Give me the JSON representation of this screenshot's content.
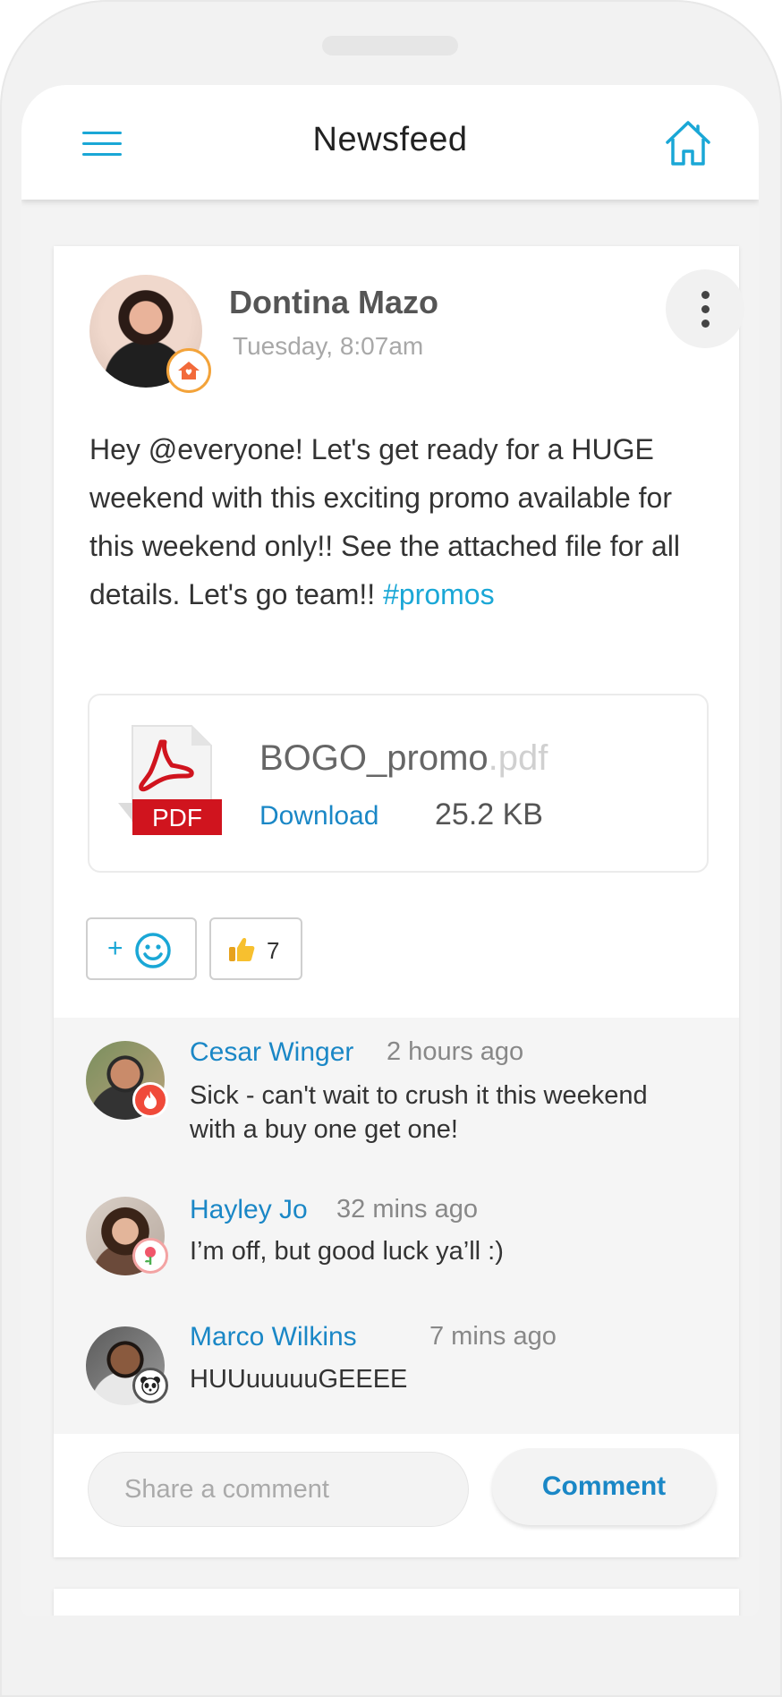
{
  "header": {
    "title": "Newsfeed",
    "menu_icon": "hamburger-menu-icon",
    "home_icon": "home-icon"
  },
  "post": {
    "author": "Dontina Mazo",
    "timestamp": "Tuesday, 8:07am",
    "body_text": "Hey @everyone! Let's get ready for a HUGE weekend with this exciting promo available for this weekend only!! See the attached file for all details. Let's go team!!",
    "hashtag": "#promos",
    "attachment": {
      "file_base": "BOGO_promo",
      "file_ext": ".pdf",
      "icon_label": "PDF",
      "download_label": "Download",
      "size": "25.2 KB"
    },
    "reactions": {
      "add_label": "+",
      "like_count": "7"
    }
  },
  "comments": [
    {
      "name": "Cesar Winger",
      "time": "2 hours ago",
      "text": "Sick - can't wait to crush it this weekend with a buy one get one!",
      "badge": "fire-icon"
    },
    {
      "name": "Hayley Jo",
      "time": "32 mins ago",
      "text": "I’m off, but good luck ya’ll :)",
      "badge": "flower-icon"
    },
    {
      "name": "Marco Wilkins",
      "time": "7 mins ago",
      "text": "HUUuuuuuGEEEE",
      "badge": "panda-icon"
    }
  ],
  "composer": {
    "placeholder": "Share a comment",
    "button_label": "Comment"
  },
  "colors": {
    "accent": "#1aa7d6",
    "link": "#1a87c6",
    "pdf_red": "#d0141e"
  }
}
